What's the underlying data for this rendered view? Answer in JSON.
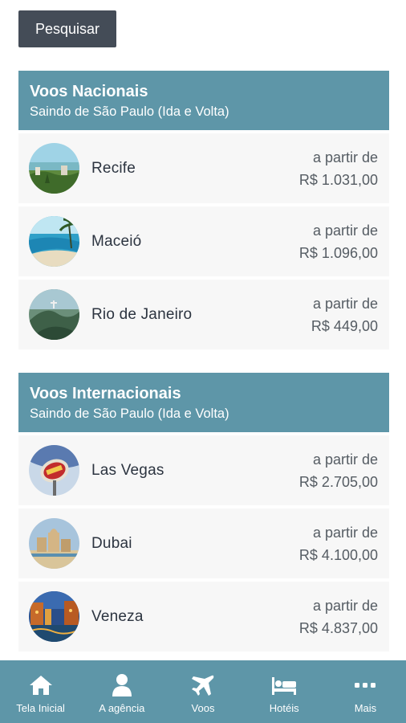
{
  "search_button": {
    "label": "Pesquisar"
  },
  "sections": [
    {
      "title": "Voos Nacionais",
      "subtitle": "Saindo de São Paulo (Ida e Volta)",
      "destinations": [
        {
          "name": "Recife",
          "price_prefix": "a partir de",
          "price": "R$ 1.031,00",
          "image": "recife-photo"
        },
        {
          "name": "Maceió",
          "price_prefix": "a partir de",
          "price": "R$ 1.096,00",
          "image": "maceio-photo"
        },
        {
          "name": "Rio de Janeiro",
          "price_prefix": "a partir de",
          "price": "R$ 449,00",
          "image": "rio-photo"
        }
      ]
    },
    {
      "title": "Voos Internacionais",
      "subtitle": "Saindo de São Paulo (Ida e Volta)",
      "destinations": [
        {
          "name": "Las Vegas",
          "price_prefix": "a partir de",
          "price": "R$ 2.705,00",
          "image": "las-vegas-photo"
        },
        {
          "name": "Dubai",
          "price_prefix": "a partir de",
          "price": "R$ 4.100,00",
          "image": "dubai-photo"
        },
        {
          "name": "Veneza",
          "price_prefix": "a partir de",
          "price": "R$ 4.837,00",
          "image": "veneza-photo"
        }
      ]
    }
  ],
  "bottom_nav": [
    {
      "label": "Tela Inicial",
      "icon": "home-icon"
    },
    {
      "label": "A agência",
      "icon": "user-icon"
    },
    {
      "label": "Voos",
      "icon": "plane-icon"
    },
    {
      "label": "Hotéis",
      "icon": "bed-icon"
    },
    {
      "label": "Mais",
      "icon": "more-icon"
    }
  ],
  "colors": {
    "header": "#5e96a8",
    "search_button": "#444c57",
    "row_background": "#f7f7f7",
    "nav_background": "#5e96a8"
  }
}
